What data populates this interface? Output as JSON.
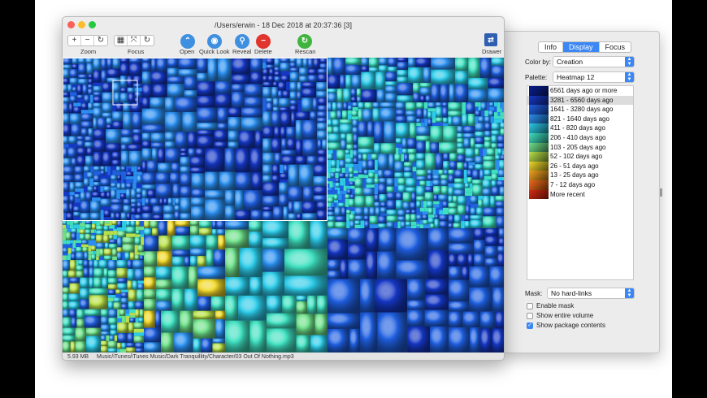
{
  "window": {
    "title": "/Users/erwin - 18 Dec 2018 at 20:37:36 [3]"
  },
  "toolbar": {
    "zoom_label": "Zoom",
    "focus_label": "Focus",
    "open_label": "Open",
    "quicklook_label": "Quick Look",
    "reveal_label": "Reveal",
    "delete_label": "Delete",
    "rescan_label": "Rescan",
    "drawer_label": "Drawer",
    "zoom_in_glyph": "+",
    "zoom_out_glyph": "−",
    "zoom_reset_glyph": "↻"
  },
  "drawer": {
    "tabs": [
      "Info",
      "Display",
      "Focus"
    ],
    "active_tab": "Display",
    "color_by_label": "Color by:",
    "color_by_value": "Creation",
    "palette_label": "Palette:",
    "palette_value": "Heatmap 12",
    "legend": [
      {
        "label": "6561 days ago or more",
        "color": "#0a1f8f"
      },
      {
        "label": "3281 - 6560 days ago",
        "color": "#1537c4"
      },
      {
        "label": "1641 - 3280 days ago",
        "color": "#1f5fe0"
      },
      {
        "label": "821 - 1640 days ago",
        "color": "#2b8ff0"
      },
      {
        "label": "411 - 820 days ago",
        "color": "#2ccbe8"
      },
      {
        "label": "206 - 410 days ago",
        "color": "#3fe0c0"
      },
      {
        "label": "103 - 205 days ago",
        "color": "#6fe08a"
      },
      {
        "label": "52 - 102 days ago",
        "color": "#b8e04a"
      },
      {
        "label": "26 - 51 days ago",
        "color": "#f0d82a"
      },
      {
        "label": "13 - 25 days ago",
        "color": "#f3a21e"
      },
      {
        "label": "7 - 12 days ago",
        "color": "#ee6a1a"
      },
      {
        "label": "More recent",
        "color": "#d82a12"
      }
    ],
    "selected_legend_index": 1,
    "mask_label": "Mask:",
    "mask_value": "No hard-links",
    "checkboxes": [
      {
        "label": "Enable mask",
        "checked": false
      },
      {
        "label": "Show entire volume",
        "checked": false
      },
      {
        "label": "Show package contents",
        "checked": true
      }
    ]
  },
  "status": {
    "size": "5.93 MB",
    "path": "Music/iTunes/iTunes Music/Dark Tranquillity/Character/03 Out Of Nothing.mp3"
  },
  "colors": {
    "accent": "#3a87f5",
    "open": "#3f8fe0",
    "quicklook": "#3f8fe0",
    "reveal": "#3f8fe0",
    "delete": "#e0342c",
    "rescan": "#3fb53f"
  }
}
